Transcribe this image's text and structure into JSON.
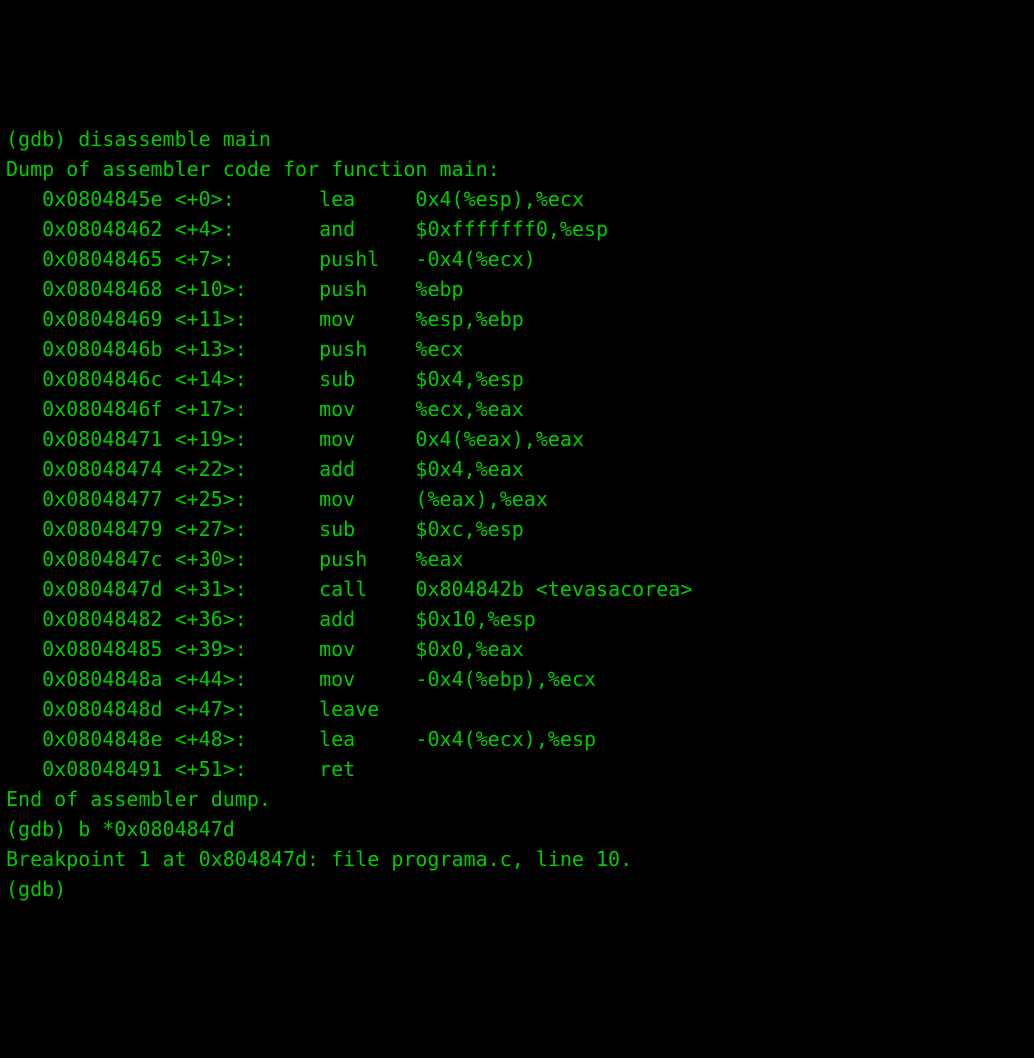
{
  "prompt": "(gdb) ",
  "cmd_disasm": "disassemble main",
  "dump_header": "Dump of assembler code for function main:",
  "dump_footer": "End of assembler dump.",
  "instructions": [
    {
      "addr": "0x0804845e",
      "off": "<+0>:",
      "mn": "lea",
      "opd": "0x4(%esp),%ecx"
    },
    {
      "addr": "0x08048462",
      "off": "<+4>:",
      "mn": "and",
      "opd": "$0xfffffff0,%esp"
    },
    {
      "addr": "0x08048465",
      "off": "<+7>:",
      "mn": "pushl",
      "opd": "-0x4(%ecx)"
    },
    {
      "addr": "0x08048468",
      "off": "<+10>:",
      "mn": "push",
      "opd": "%ebp"
    },
    {
      "addr": "0x08048469",
      "off": "<+11>:",
      "mn": "mov",
      "opd": "%esp,%ebp"
    },
    {
      "addr": "0x0804846b",
      "off": "<+13>:",
      "mn": "push",
      "opd": "%ecx"
    },
    {
      "addr": "0x0804846c",
      "off": "<+14>:",
      "mn": "sub",
      "opd": "$0x4,%esp"
    },
    {
      "addr": "0x0804846f",
      "off": "<+17>:",
      "mn": "mov",
      "opd": "%ecx,%eax"
    },
    {
      "addr": "0x08048471",
      "off": "<+19>:",
      "mn": "mov",
      "opd": "0x4(%eax),%eax"
    },
    {
      "addr": "0x08048474",
      "off": "<+22>:",
      "mn": "add",
      "opd": "$0x4,%eax"
    },
    {
      "addr": "0x08048477",
      "off": "<+25>:",
      "mn": "mov",
      "opd": "(%eax),%eax"
    },
    {
      "addr": "0x08048479",
      "off": "<+27>:",
      "mn": "sub",
      "opd": "$0xc,%esp"
    },
    {
      "addr": "0x0804847c",
      "off": "<+30>:",
      "mn": "push",
      "opd": "%eax"
    },
    {
      "addr": "0x0804847d",
      "off": "<+31>:",
      "mn": "call",
      "opd": "0x804842b <tevasacorea>"
    },
    {
      "addr": "0x08048482",
      "off": "<+36>:",
      "mn": "add",
      "opd": "$0x10,%esp"
    },
    {
      "addr": "0x08048485",
      "off": "<+39>:",
      "mn": "mov",
      "opd": "$0x0,%eax"
    },
    {
      "addr": "0x0804848a",
      "off": "<+44>:",
      "mn": "mov",
      "opd": "-0x4(%ebp),%ecx"
    },
    {
      "addr": "0x0804848d",
      "off": "<+47>:",
      "mn": "leave",
      "opd": ""
    },
    {
      "addr": "0x0804848e",
      "off": "<+48>:",
      "mn": "lea",
      "opd": "-0x4(%ecx),%esp"
    },
    {
      "addr": "0x08048491",
      "off": "<+51>:",
      "mn": "ret",
      "opd": ""
    }
  ],
  "cmd_break": "b *0x0804847d",
  "break_result": "Breakpoint 1 at 0x804847d: file programa.c, line 10.",
  "offset_col_width": 7,
  "mnemonic_col_start": 23
}
